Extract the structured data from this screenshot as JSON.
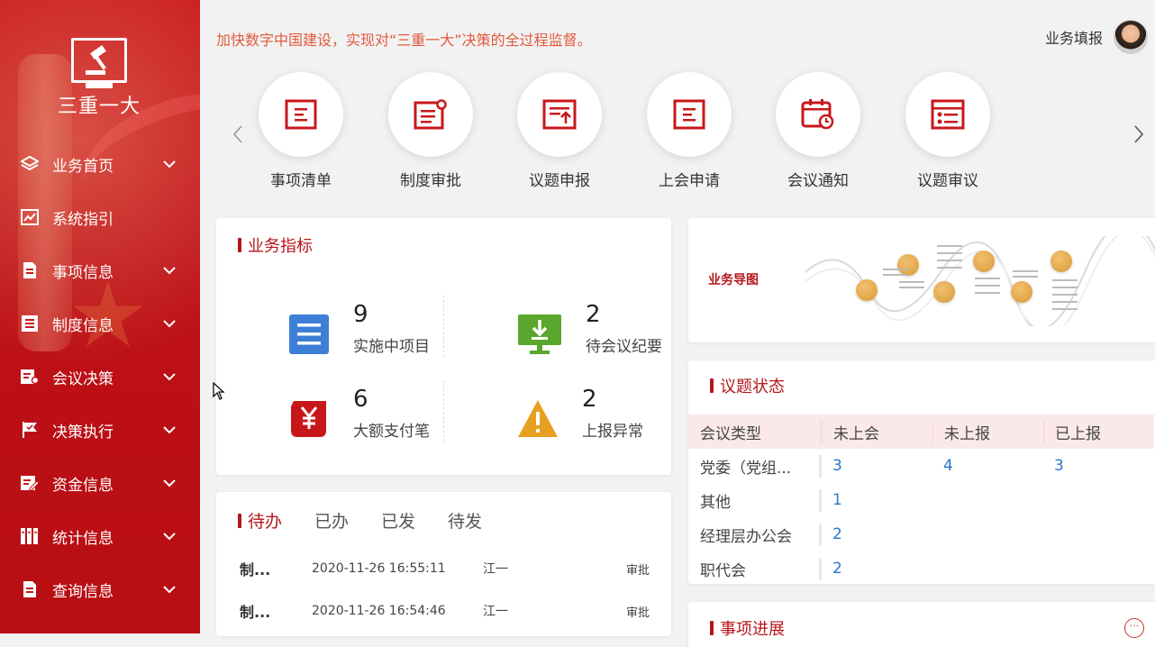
{
  "sidebar": {
    "logo_title": "三重一大",
    "items": [
      {
        "label": "业务首页",
        "icon": "layers-icon"
      },
      {
        "label": "系统指引",
        "icon": "chart-icon"
      },
      {
        "label": "事项信息",
        "icon": "document-icon"
      },
      {
        "label": "制度信息",
        "icon": "list-icon"
      },
      {
        "label": "会议决策",
        "icon": "meeting-icon"
      },
      {
        "label": "决策执行",
        "icon": "flag-icon"
      },
      {
        "label": "资金信息",
        "icon": "edit-icon"
      },
      {
        "label": "统计信息",
        "icon": "books-icon"
      },
      {
        "label": "查询信息",
        "icon": "document-icon"
      }
    ]
  },
  "header": {
    "slogan": "加快数字中国建设，实现对“三重一大”决策的全过程监督。",
    "user_label": "业务填报"
  },
  "quick_links": [
    {
      "label": "事项清单",
      "icon": "list-doc-icon"
    },
    {
      "label": "制度审批",
      "icon": "approval-doc-icon"
    },
    {
      "label": "议题申报",
      "icon": "upload-doc-icon"
    },
    {
      "label": "上会申请",
      "icon": "list-doc-icon"
    },
    {
      "label": "会议通知",
      "icon": "calendar-clock-icon"
    },
    {
      "label": "议题审议",
      "icon": "checklist-icon"
    }
  ],
  "metrics": {
    "title": "业务指标",
    "items": [
      {
        "value": "9",
        "label": "实施中项目",
        "icon": "list-icon",
        "color": "#3d7fd6"
      },
      {
        "value": "2",
        "label": "待会议纪要",
        "icon": "monitor-download-icon",
        "color": "#5ba62d"
      },
      {
        "value": "6",
        "label": "大额支付笔",
        "icon": "yuan-scroll-icon",
        "color": "#c8171b"
      },
      {
        "value": "2",
        "label": "上报异常",
        "icon": "warning-icon",
        "color": "#e8a020"
      }
    ]
  },
  "todo": {
    "tabs": [
      "待办",
      "已办",
      "已发",
      "待发"
    ],
    "rows": [
      {
        "title": "制...",
        "time": "2020-11-26 16:55:11",
        "user": "江一",
        "action": "审批"
      },
      {
        "title": "制...",
        "time": "2020-11-26 16:54:46",
        "user": "江一",
        "action": "审批"
      }
    ]
  },
  "business_map": {
    "title": "业务导图"
  },
  "topic_status": {
    "title": "议题状态",
    "columns": [
      "会议类型",
      "未上会",
      "未上报",
      "已上报"
    ],
    "rows": [
      {
        "type": "党委（党组...",
        "values": [
          "3",
          "4",
          "3"
        ]
      },
      {
        "type": "其他",
        "values": [
          "1",
          "",
          ""
        ]
      },
      {
        "type": "经理层办公会",
        "values": [
          "2",
          "",
          ""
        ]
      },
      {
        "type": "职代会",
        "values": [
          "2",
          "",
          ""
        ]
      }
    ]
  },
  "progress": {
    "title": "事项进展",
    "more": "···"
  },
  "colors": {
    "brand": "#c8171b",
    "accent_text": "#b5161b",
    "slogan": "#e15a3e",
    "link": "#2878c8"
  }
}
